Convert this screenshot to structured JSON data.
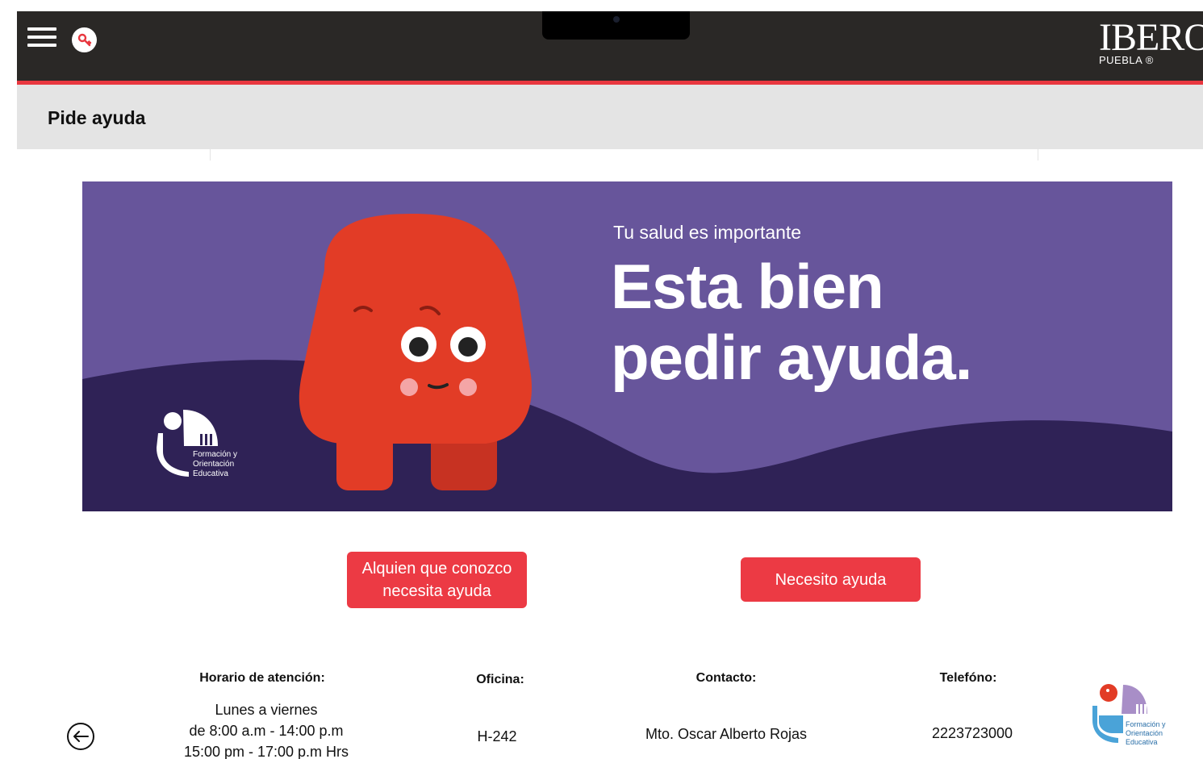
{
  "header": {
    "menu_icon": "hamburger-menu-icon",
    "key_icon": "key-icon",
    "brand_name": "IBERO",
    "brand_sub": "PUEBLA ®"
  },
  "title_bar": {
    "title": "Pide ayuda"
  },
  "banner": {
    "subtitle": "Tu salud es importante",
    "headline_line1": "Esta bien",
    "headline_line2": "pedir ayuda.",
    "logo_line1": "Formación y",
    "logo_line2": "Orientación",
    "logo_line3": "Educativa"
  },
  "actions": {
    "someone_needs_help": "Alquien que conozco necesita ayuda",
    "i_need_help": "Necesito ayuda"
  },
  "info": {
    "hours_label": "Horario de atención:",
    "hours_line1": "Lunes a viernes",
    "hours_line2": "de 8:00 a.m - 14:00 p.m",
    "hours_line3": "15:00 pm - 17:00 p.m Hrs",
    "office_label": "Oficina:",
    "office_value": "H-242",
    "contact_label": "Contacto:",
    "contact_value": "Mto. Oscar Alberto Rojas",
    "phone_label": "Telefóno:",
    "phone_value": "2223723000"
  },
  "footer_logo": {
    "line1": "Formación y",
    "line2": "Orientación",
    "line3": "Educativa"
  },
  "colors": {
    "topbar": "#2a2826",
    "accent_red": "#e8373f",
    "banner_purple": "#67559b",
    "banner_dark": "#2f2256",
    "mascot": "#e23c26"
  }
}
